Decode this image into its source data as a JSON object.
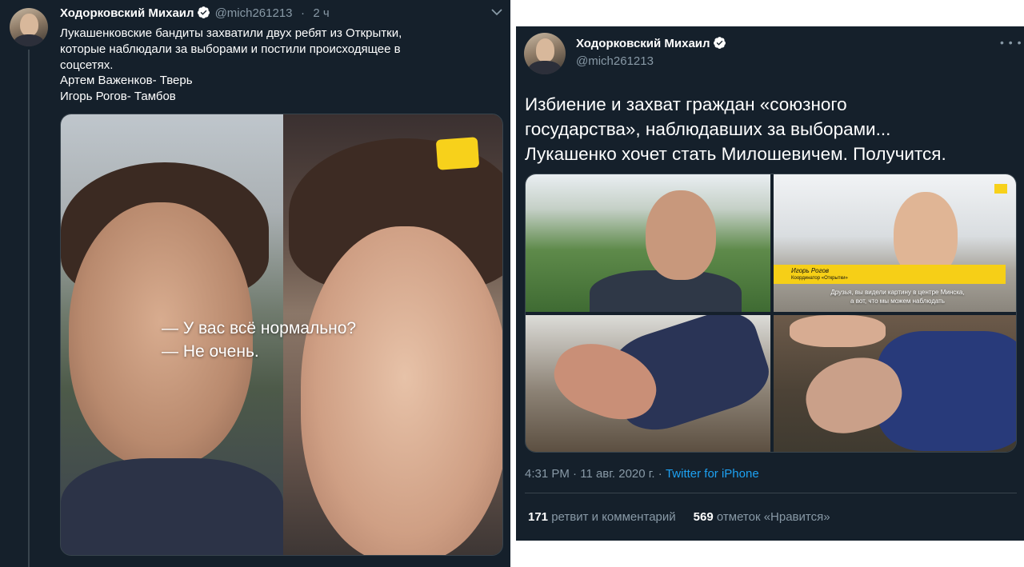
{
  "colors": {
    "background": "#15202b",
    "text": "#ffffff",
    "secondary_text": "#8899a6",
    "link": "#1da1f2",
    "verified": "#ffffff",
    "divider": "#38444d",
    "highlight_yellow": "#f7d11b"
  },
  "left_tweet": {
    "author_name": "Ходорковский Михаил",
    "verified_icon": "verified-badge",
    "handle": "@mich261213",
    "separator": "·",
    "time": "2 ч",
    "menu_icon": "chevron-down",
    "text_lines": [
      "Лукашенковские бандиты захватили двух ребят из Открытки,",
      "которые наблюдали за выборами и постили происходящее в",
      "соцсетях.",
      "Артем Важенков- Тверь",
      "Игорь Рогов- Тамбов"
    ],
    "media_subtitle_lines": [
      "— У вас всё нормально?",
      "— Не очень."
    ]
  },
  "right_tweet": {
    "author_name": "Ходорковский Михаил",
    "verified_icon": "verified-badge",
    "handle": "@mich261213",
    "more_icon": "more-dots",
    "text_lines": [
      "Избиение и захват граждан «союзного",
      "государства», наблюдавших за выборами...",
      "Лукашенко хочет стать Милошевичем. Получится."
    ],
    "media_caption": {
      "name": "Игорь Рогов",
      "role": "Координатор «Открытки»",
      "quote_lines": [
        "Друзья, вы видели картину в центре Минска,",
        "а вот, что мы можем наблюдать"
      ]
    },
    "time": "4:31 PM",
    "date_separator": "·",
    "date": "11 авг. 2020 г.",
    "source": "Twitter for iPhone",
    "retweets_count": "171",
    "retweets_label": "ретвит и комментарий",
    "likes_count": "569",
    "likes_label": "отметок «Нравится»"
  }
}
